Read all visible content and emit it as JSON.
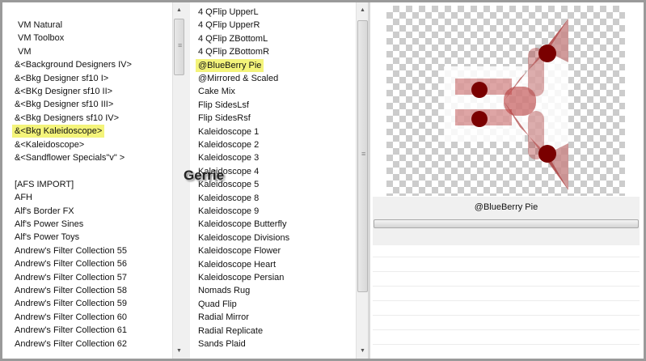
{
  "left_list": {
    "items": [
      "VM Natural",
      "VM Toolbox",
      "VM",
      "&<Background Designers IV>",
      "&<Bkg Designer sf10 I>",
      "&<BKg Designer sf10 II>",
      "&<Bkg Designer sf10 III>",
      "&<Bkg Designers sf10 IV>",
      "&<Bkg Kaleidoscope>",
      "&<Kaleidoscope>",
      "&<Sandflower Specials\"v\" >",
      "",
      "[AFS IMPORT]",
      "AFH",
      "Alf's Border FX",
      "Alf's Power Sines",
      "Alf's Power Toys",
      "Andrew's Filter Collection 55",
      "Andrew's Filter Collection 56",
      "Andrew's Filter Collection 57",
      "Andrew's Filter Collection 58",
      "Andrew's Filter Collection 59",
      "Andrew's Filter Collection 60",
      "Andrew's Filter Collection 61",
      "Andrew's Filter Collection 62"
    ],
    "selected": "&<Bkg Kaleidoscope>"
  },
  "middle_list": {
    "items": [
      "4 QFlip UpperL",
      "4 QFlip UpperR",
      "4 QFlip ZBottomL",
      "4 QFlip ZBottomR",
      "@BlueBerry Pie",
      "@Mirrored & Scaled",
      "Cake Mix",
      "Flip SidesLsf",
      "Flip SidesRsf",
      "Kaleidoscope 1",
      "Kaleidoscope 2",
      "Kaleidoscope 3",
      "Kaleidoscope 4",
      "Kaleidoscope 5",
      "Kaleidoscope 8",
      "Kaleidoscope 9",
      "Kaleidoscope Butterfly",
      "Kaleidoscope Divisions",
      "Kaleidoscope Flower",
      "Kaleidoscope Heart",
      "Kaleidoscope Persian",
      "Nomads Rug",
      "Quad Flip",
      "Radial Mirror",
      "Radial Replicate",
      "Sands Plaid"
    ],
    "selected": "@BlueBerry Pie"
  },
  "preview": {
    "filter_name": "@BlueBerry Pie"
  },
  "watermark": "Gerrie",
  "colors": {
    "highlight": "#f4f47a",
    "art_dark": "#7a0000",
    "art_light": "#c98a8a"
  }
}
